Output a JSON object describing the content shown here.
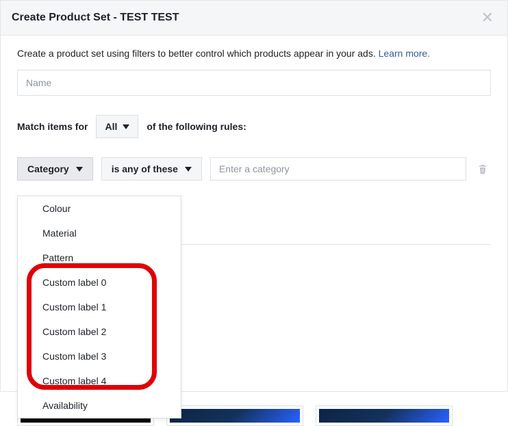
{
  "header": {
    "title": "Create Product Set - TEST TEST"
  },
  "description": {
    "text": "Create a product set using filters to better control which products appear in your ads. ",
    "learn_more": "Learn more."
  },
  "name_field": {
    "placeholder": "Name"
  },
  "match": {
    "prefix": "Match items for",
    "selector_label": "All",
    "suffix": "of the following rules:"
  },
  "rule": {
    "field_label": "Category",
    "operator_label": "is any of these",
    "value_placeholder": "Enter a category"
  },
  "dropdown": {
    "items": [
      "Colour",
      "Material",
      "Pattern",
      "Custom label 0",
      "Custom label 1",
      "Custom label 2",
      "Custom label 3",
      "Custom label 4",
      "Availability"
    ]
  }
}
